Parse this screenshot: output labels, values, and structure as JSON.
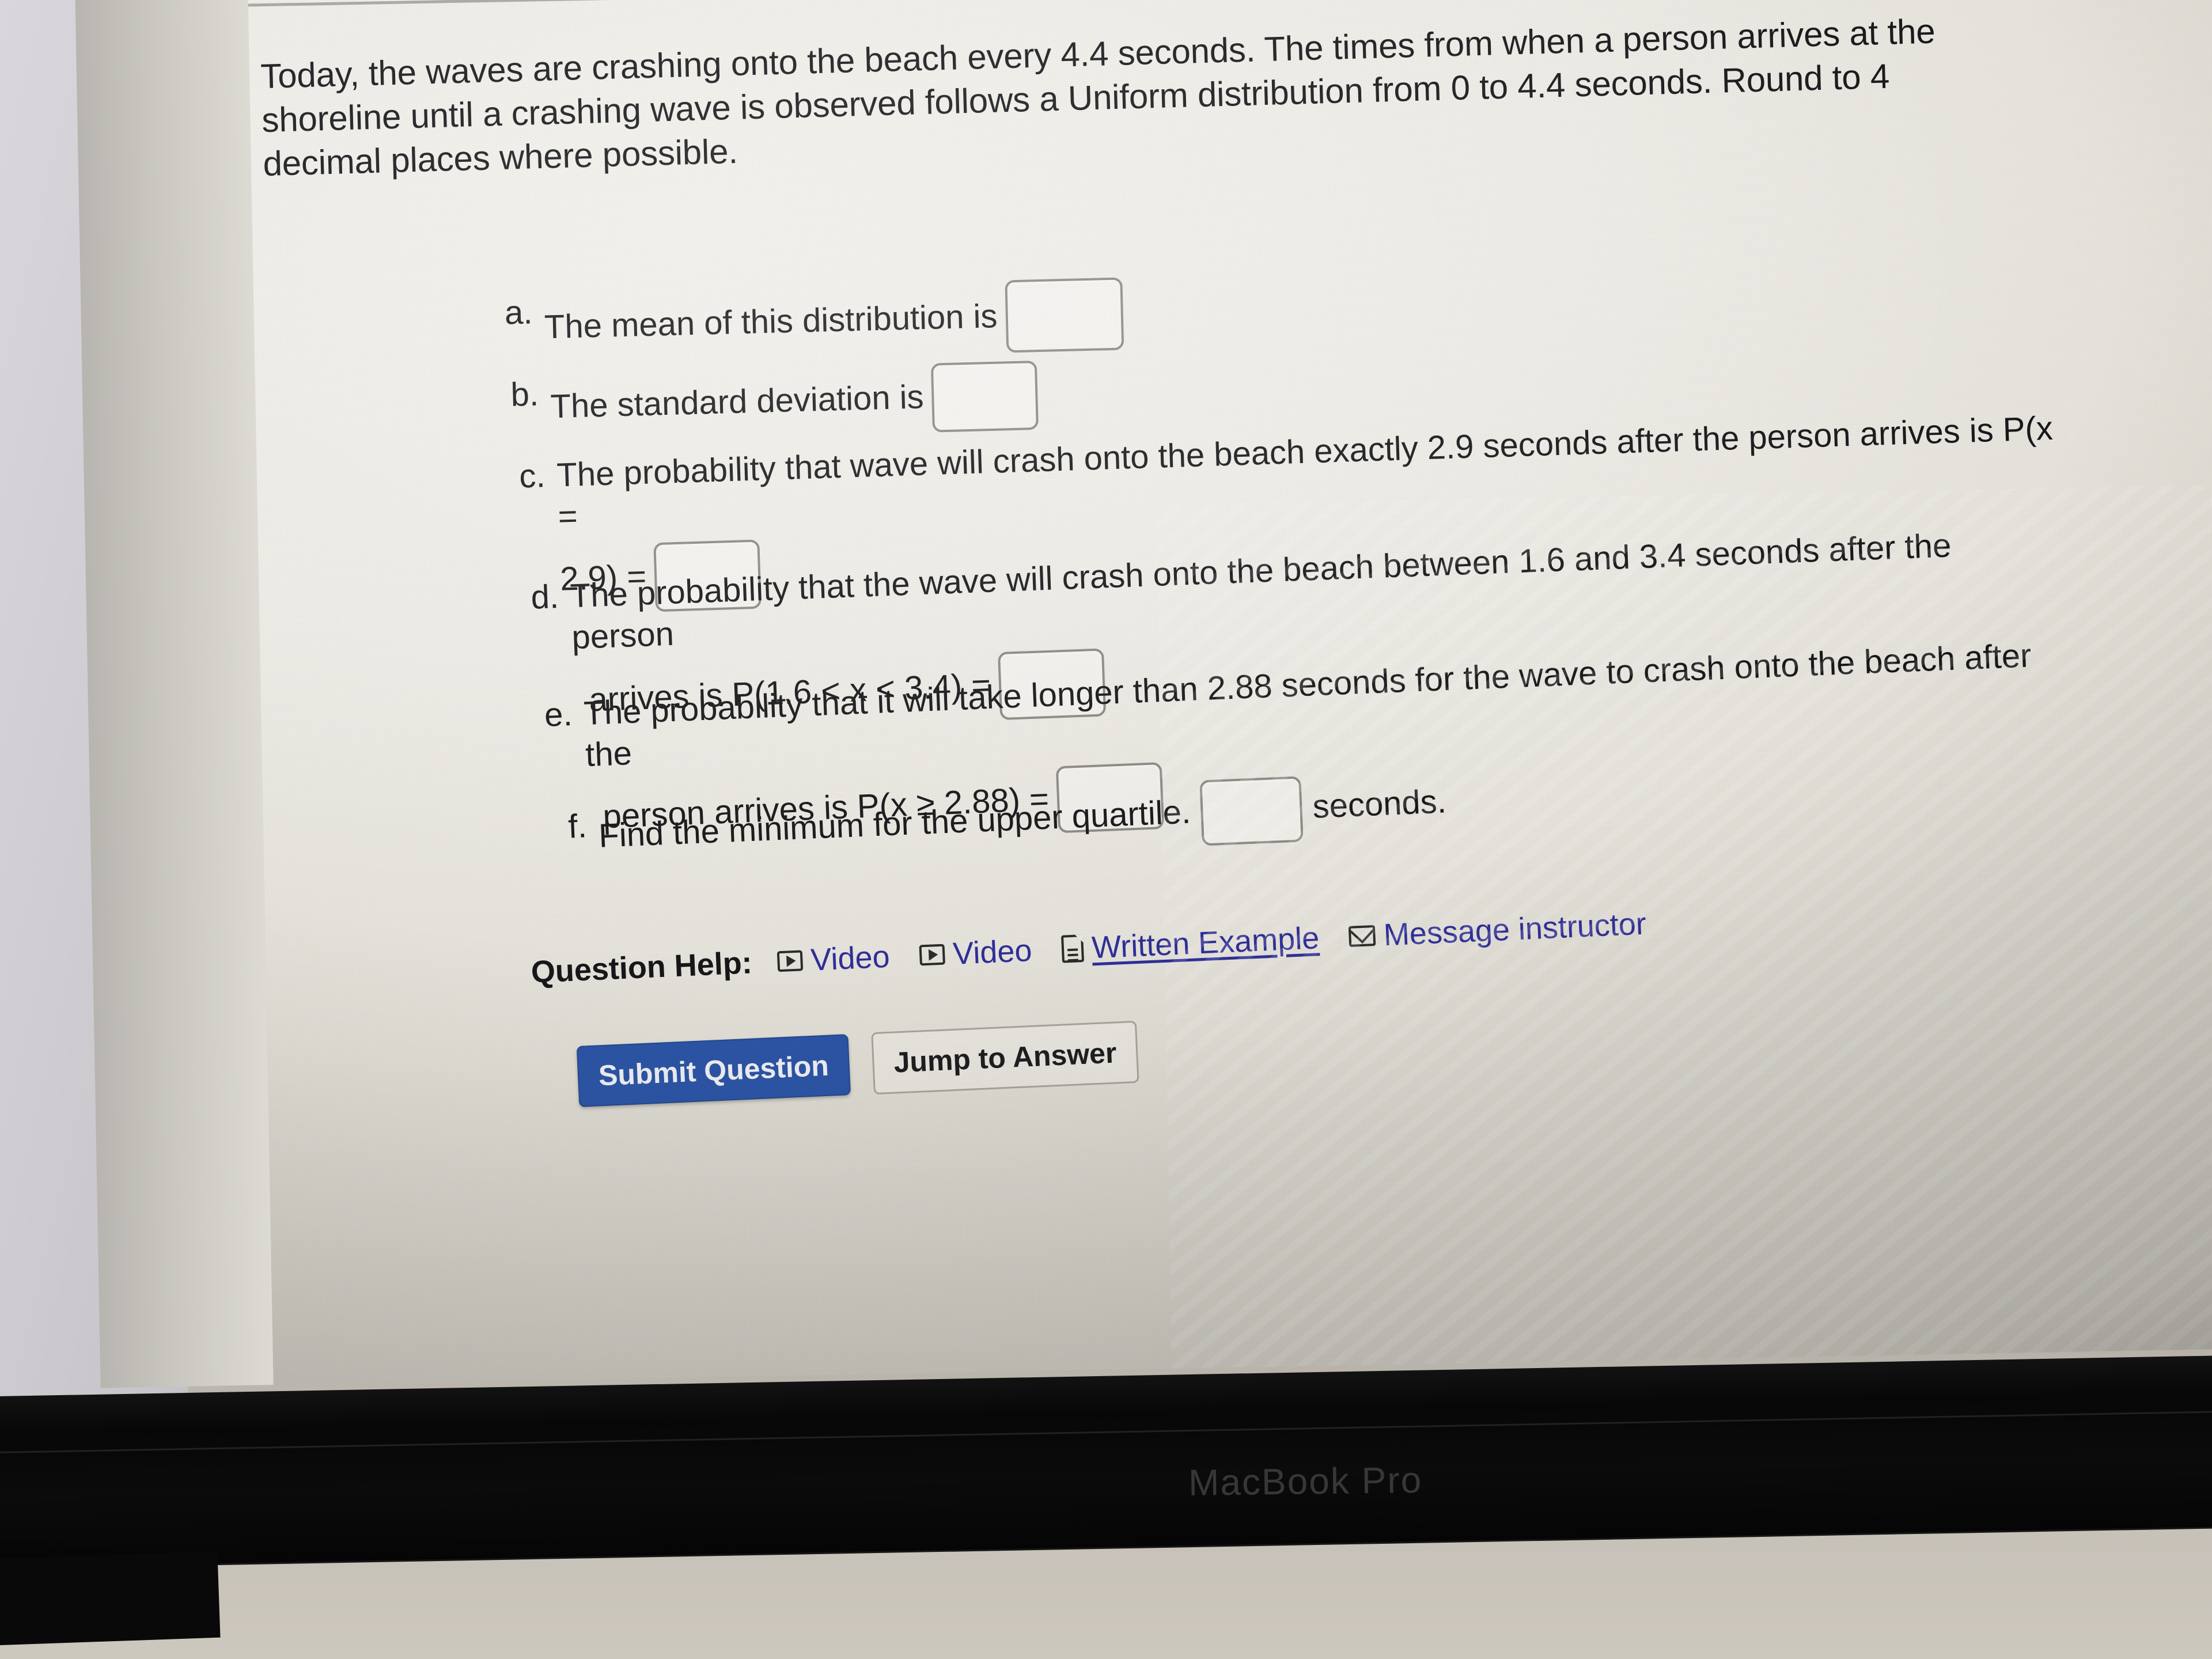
{
  "question": {
    "stem": "Today, the waves are crashing onto the beach every 4.4 seconds. The times from when a person arrives at the shoreline until a crashing wave is observed follows a Uniform distribution from 0 to 4.4 seconds. Round to 4 decimal places where possible.",
    "parts": [
      {
        "marker": "a.",
        "line1": "The mean of this distribution is",
        "line2": "",
        "answer_value": ""
      },
      {
        "marker": "b.",
        "line1": "The standard deviation is",
        "line2": "",
        "answer_value": ""
      },
      {
        "marker": "c.",
        "line1": "The probability that wave will crash onto the beach exactly 2.9 seconds after the person arrives is P(x =",
        "line2": "2.9) =",
        "answer_value": ""
      },
      {
        "marker": "d.",
        "line1": "The probability that the wave will crash onto the beach between 1.6 and 3.4 seconds after the person",
        "line2": "arrives is P(1.6 < x < 3.4) =",
        "answer_value": ""
      },
      {
        "marker": "e.",
        "line1": "The probability that it will take longer than 2.88 seconds for the wave to crash onto the beach after the",
        "line2": "person arrives is P(x ≥ 2.88) =",
        "answer_value": ""
      },
      {
        "marker": "f.",
        "line1": "Find the minimum for the upper quartile.",
        "unit": "seconds.",
        "answer_value": ""
      }
    ]
  },
  "help": {
    "label": "Question Help:",
    "links": [
      {
        "label": "Video",
        "icon": "video-icon"
      },
      {
        "label": "Video",
        "icon": "video-icon"
      },
      {
        "label": "Written Example",
        "icon": "document-icon"
      },
      {
        "label": "Message instructor",
        "icon": "mail-icon"
      }
    ],
    "link_color": "#2f2f99"
  },
  "actions": {
    "submit_label": "Submit Question",
    "jump_label": "Jump to Answer",
    "primary_color": "#2b55a8"
  },
  "device": {
    "wordmark": "MacBook Pro"
  }
}
